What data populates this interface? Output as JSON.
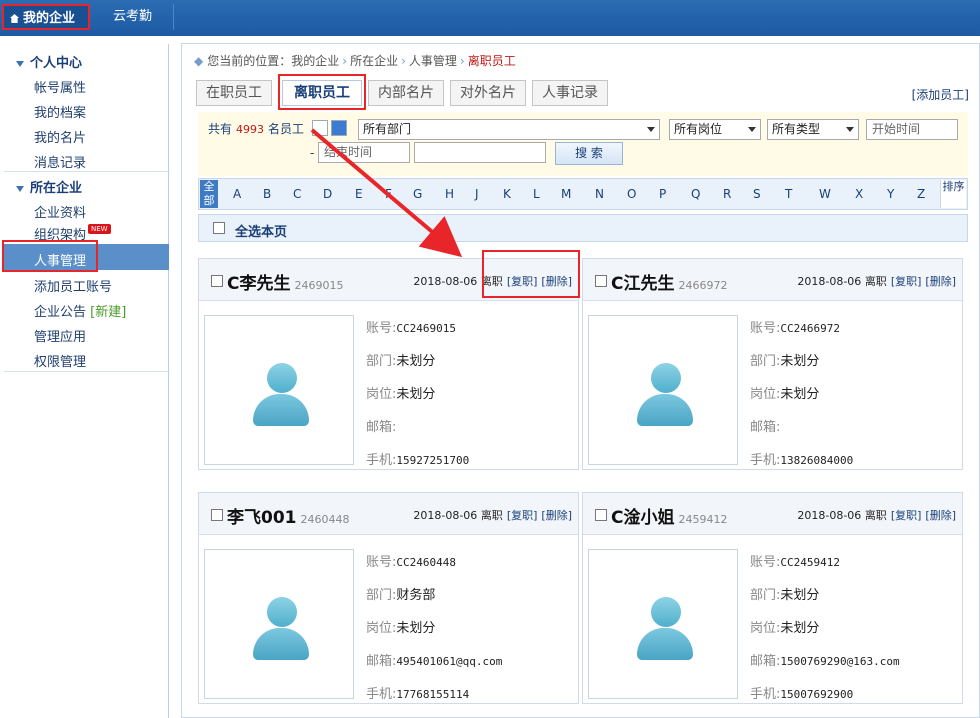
{
  "topnav": {
    "company": "我的企业",
    "attendance": "云考勤"
  },
  "sidebar": {
    "personal": {
      "title": "个人中心",
      "items": [
        {
          "label": "帐号属性"
        },
        {
          "label": "我的档案"
        },
        {
          "label": "我的名片"
        },
        {
          "label": "消息记录"
        }
      ]
    },
    "company": {
      "title": "所在企业",
      "items": [
        {
          "label": "企业资料"
        },
        {
          "label": "组织架构",
          "badge": "NEW"
        },
        {
          "label": "人事管理"
        },
        {
          "label": "添加员工账号"
        },
        {
          "label": "企业公告",
          "link": "[新建]"
        },
        {
          "label": "管理应用"
        },
        {
          "label": "权限管理"
        }
      ]
    }
  },
  "breadcrumb": {
    "prefix": "您当前的位置：",
    "items": [
      "我的企业",
      "所在企业",
      "人事管理"
    ],
    "current": "离职员工"
  },
  "tabs": [
    {
      "label": "在职员工"
    },
    {
      "label": "离职员工"
    },
    {
      "label": "内部名片"
    },
    {
      "label": "对外名片"
    },
    {
      "label": "人事记录"
    }
  ],
  "add_employee": "[添加员工]",
  "filter": {
    "count_prefix": "共有",
    "count": "4993",
    "count_suffix": "名员工",
    "department": "所有部门",
    "position": "所有岗位",
    "type": "所有类型",
    "start_placeholder": "开始时间",
    "end_placeholder": "结束时间",
    "dash": "-",
    "search_label": "搜 索"
  },
  "alphabet": {
    "all": "全部",
    "sort": "排序",
    "letters": [
      "A",
      "B",
      "C",
      "D",
      "E",
      "F",
      "G",
      "H",
      "J",
      "K",
      "L",
      "M",
      "N",
      "O",
      "P",
      "Q",
      "R",
      "S",
      "T",
      "W",
      "X",
      "Y",
      "Z"
    ]
  },
  "select_all": "全选本页",
  "labels": {
    "account": "账号:",
    "department": "部门:",
    "position": "岗位:",
    "email": "邮箱:",
    "phone": "手机:"
  },
  "employees": [
    {
      "name": "C李先生",
      "id": "2469015",
      "date": "2018-08-06",
      "status": "离职",
      "rehire": "[复职]",
      "delete": "[删除]",
      "account": "CC2469015",
      "department": "未划分",
      "position": "未划分",
      "email": "",
      "phone": "15927251700"
    },
    {
      "name": "C江先生",
      "id": "2466972",
      "date": "2018-08-06",
      "status": "离职",
      "rehire": "[复职]",
      "delete": "[删除]",
      "account": "CC2466972",
      "department": "未划分",
      "position": "未划分",
      "email": "",
      "phone": "13826084000"
    },
    {
      "name": "李飞001",
      "id": "2460448",
      "date": "2018-08-06",
      "status": "离职",
      "rehire": "[复职]",
      "delete": "[删除]",
      "account": "CC2460448",
      "department": "财务部",
      "position": "未划分",
      "email": "495401061@qq.com",
      "phone": "17768155114"
    },
    {
      "name": "C淦小姐",
      "id": "2459412",
      "date": "2018-08-06",
      "status": "离职",
      "rehire": "[复职]",
      "delete": "[删除]",
      "account": "CC2459412",
      "department": "未划分",
      "position": "未划分",
      "email": "1500769290@163.com",
      "phone": "15007692900"
    }
  ],
  "colors": {
    "accent": "#1d5aa3",
    "highlight": "#e8262a",
    "active_nav": "#5b8fc9"
  }
}
